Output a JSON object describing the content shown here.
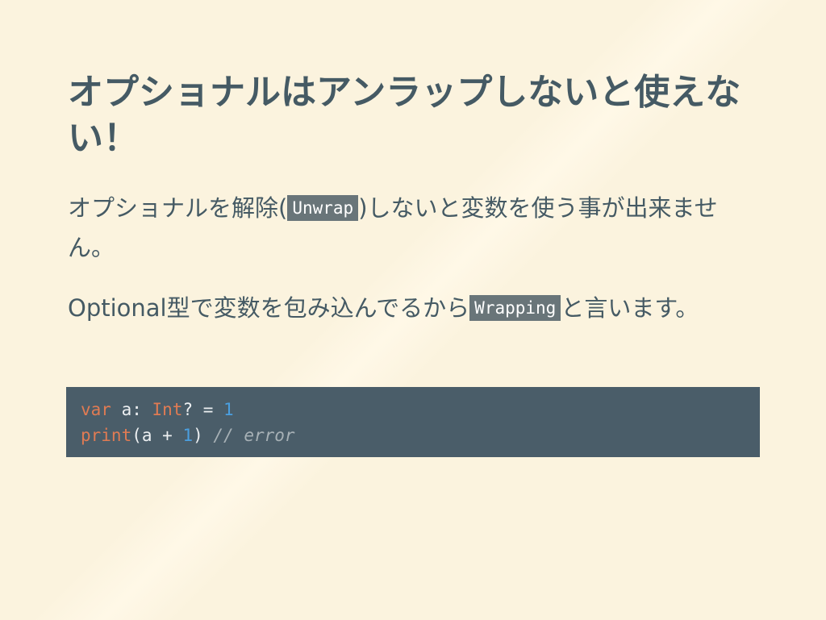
{
  "slide": {
    "title": "オプショナルはアンラップしないと使えない！",
    "paragraph1": {
      "before": "オプショナルを解除(",
      "code": "Unwrap",
      "after": ")しないと変数を使う事が出来ません。"
    },
    "paragraph2": {
      "before": "Optional型で変数を包み込んでるから",
      "code": "Wrapping",
      "after": "と言います。"
    },
    "code_block": {
      "line1": {
        "kw_var": "var",
        "ident_a": " a: ",
        "type_int": "Int",
        "rest": "? = ",
        "num_1": "1"
      },
      "line2": {
        "fn_print": "print",
        "args_open": "(a + ",
        "num_1": "1",
        "args_close": ") ",
        "comment": "// error"
      }
    }
  }
}
